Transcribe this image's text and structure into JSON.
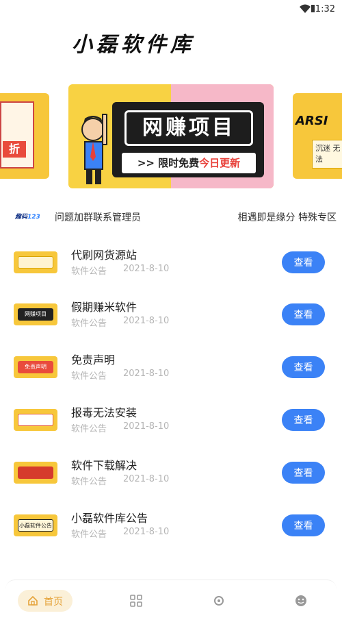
{
  "status_bar": {
    "time": "1:32"
  },
  "header": {
    "app_title": "小磊软件库"
  },
  "banner": {
    "main_title": "网赚项目",
    "main_subtitle_prefix": ">> 限时免费",
    "main_subtitle_highlight": "今日更新",
    "left_tag": "折",
    "right_code": "ARSI",
    "right_box_text": "沉迷 无法"
  },
  "notice": {
    "logo_text": "趣码",
    "logo_num": "123",
    "marquee": "问题加群联系管理员",
    "right_text": "相遇即是缘分 特殊专区"
  },
  "list": {
    "items": [
      {
        "title": "代刷网货源站",
        "category": "软件公告",
        "date": "2021-8-10",
        "button": "查看",
        "thumb_color": "#f3c24a",
        "thumb_text": ""
      },
      {
        "title": "假期赚米软件",
        "category": "软件公告",
        "date": "2021-8-10",
        "button": "查看",
        "thumb_color": "#222222",
        "thumb_text": "网赚项目"
      },
      {
        "title": "免责声明",
        "category": "软件公告",
        "date": "2021-8-10",
        "button": "查看",
        "thumb_color": "#e94b3c",
        "thumb_text": "免责声明"
      },
      {
        "title": "报毒无法安装",
        "category": "软件公告",
        "date": "2021-8-10",
        "button": "查看",
        "thumb_color": "#e35b3c",
        "thumb_text": ""
      },
      {
        "title": "软件下载解决",
        "category": "软件公告",
        "date": "2021-8-10",
        "button": "查看",
        "thumb_color": "#d63a2c",
        "thumb_text": ""
      },
      {
        "title": "小磊软件库公告",
        "category": "软件公告",
        "date": "2021-8-10",
        "button": "查看",
        "thumb_color": "#f3c24a",
        "thumb_text": "小磊软件公告"
      }
    ]
  },
  "bottom_nav": {
    "home_label": "首页",
    "tabs": [
      "home-icon",
      "grid-icon",
      "settings-icon",
      "smile-icon"
    ]
  },
  "colors": {
    "accent_blue": "#3b82f6",
    "home_active": "#e5a33b",
    "banner_yellow": "#f8d243"
  }
}
